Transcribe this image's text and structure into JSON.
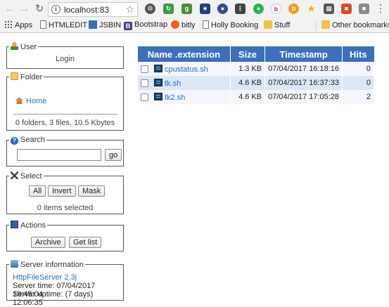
{
  "browser": {
    "url": "localhost:83",
    "bookmarks": [
      {
        "label": "Apps",
        "icon": "apps-grid-icon"
      },
      {
        "label": "HTMLEDIT",
        "icon": "page-icon"
      },
      {
        "label": "JSBIN",
        "icon": "edit-icon"
      },
      {
        "label": "Bootstrap",
        "icon": "bootstrap-icon"
      },
      {
        "label": "bitly",
        "icon": "bitly-icon"
      },
      {
        "label": "Holly Booking",
        "icon": "page-icon"
      },
      {
        "label": "Stuff",
        "icon": "folder-icon"
      },
      {
        "label": "Other bookmarks",
        "icon": "folder-icon"
      }
    ]
  },
  "sidebar": {
    "user": {
      "legend": "User",
      "login": "Login"
    },
    "folder": {
      "legend": "Folder",
      "home": "Home",
      "summary": "0 folders, 3 files, 10.5 Kbytes"
    },
    "search": {
      "legend": "Search",
      "placeholder": "",
      "go": "go"
    },
    "select": {
      "legend": "Select",
      "all": "All",
      "invert": "Invert",
      "mask": "Mask",
      "status": "0 items selected"
    },
    "actions": {
      "legend": "Actions",
      "archive": "Archive",
      "get_list": "Get list"
    },
    "server": {
      "legend": "Server information",
      "name": "HttpFileServer 2.3j",
      "time": "Server time: 07/04/2017 19:45:04",
      "uptime": "Server uptime: (7 days) 12:06:35"
    }
  },
  "table": {
    "headers": [
      "Name .extension",
      "Size",
      "Timestamp",
      "Hits"
    ],
    "rows": [
      {
        "name": "cpustatus.sh",
        "size": "1.3 KB",
        "timestamp": "07/04/2017 16:18:16",
        "hits": "0"
      },
      {
        "name": "tk.sh",
        "size": "4.6 KB",
        "timestamp": "07/04/2017 16:37:33",
        "hits": "0"
      },
      {
        "name": "tk2.sh",
        "size": "4.6 KB",
        "timestamp": "07/04/2017 17:05:28",
        "hits": "2"
      }
    ]
  }
}
